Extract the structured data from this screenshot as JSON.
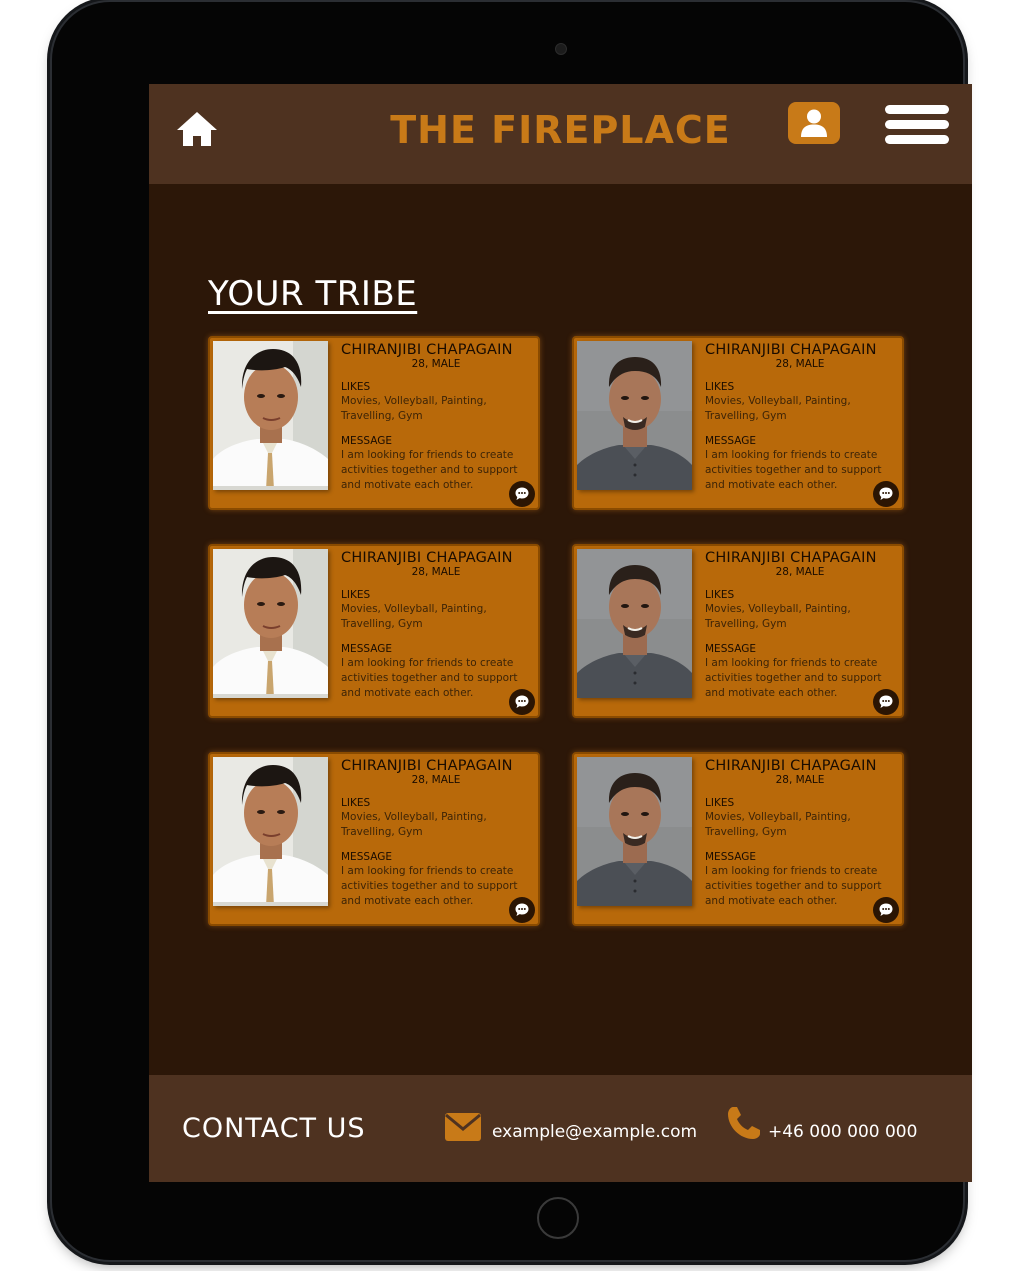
{
  "colors": {
    "accent": "#c87a18",
    "header_bg": "#4e3220",
    "screen_bg": "#2c1708",
    "card_bg": "#b8690a"
  },
  "header": {
    "title": "THE FIREPLACE",
    "home_icon": "home-icon",
    "profile_icon": "user-icon",
    "menu_icon": "hamburger-menu-icon"
  },
  "main": {
    "section_title": "YOUR TRIBE",
    "likes_label": "LIKES",
    "message_label": "MESSAGE",
    "cards": [
      {
        "name": "CHIRANJIBI CHAPAGAIN",
        "age_gender": "28, MALE",
        "likes": "Movies, Volleyball, Painting, Travelling, Gym",
        "message": "I am looking for friends to create activities together and to support and motivate each other.",
        "photo": "person-a"
      },
      {
        "name": "CHIRANJIBI CHAPAGAIN",
        "age_gender": "28, MALE",
        "likes": "Movies, Volleyball, Painting, Travelling, Gym",
        "message": "I am looking for friends to create activities together and to support and motivate each other.",
        "photo": "person-b"
      },
      {
        "name": "CHIRANJIBI CHAPAGAIN",
        "age_gender": "28, MALE",
        "likes": "Movies, Volleyball, Painting, Travelling, Gym",
        "message": "I am looking for friends to create activities together and to support and motivate each other.",
        "photo": "person-a"
      },
      {
        "name": "CHIRANJIBI CHAPAGAIN",
        "age_gender": "28, MALE",
        "likes": "Movies, Volleyball, Painting, Travelling, Gym",
        "message": "I am looking for friends to create activities together and to support and motivate each other.",
        "photo": "person-b"
      },
      {
        "name": "CHIRANJIBI CHAPAGAIN",
        "age_gender": "28, MALE",
        "likes": "Movies, Volleyball, Painting, Travelling, Gym",
        "message": "I am looking for friends to create activities together and to support and motivate each other.",
        "photo": "person-a"
      },
      {
        "name": "CHIRANJIBI CHAPAGAIN",
        "age_gender": "28, MALE",
        "likes": "Movies, Volleyball, Painting, Travelling, Gym",
        "message": "I am looking for friends to create activities together and to support and motivate each other.",
        "photo": "person-b"
      }
    ]
  },
  "footer": {
    "contact_title": "CONTACT US",
    "email": "example@example.com",
    "phone": "+46 000 000 000",
    "email_icon": "envelope-icon",
    "phone_icon": "phone-icon"
  }
}
